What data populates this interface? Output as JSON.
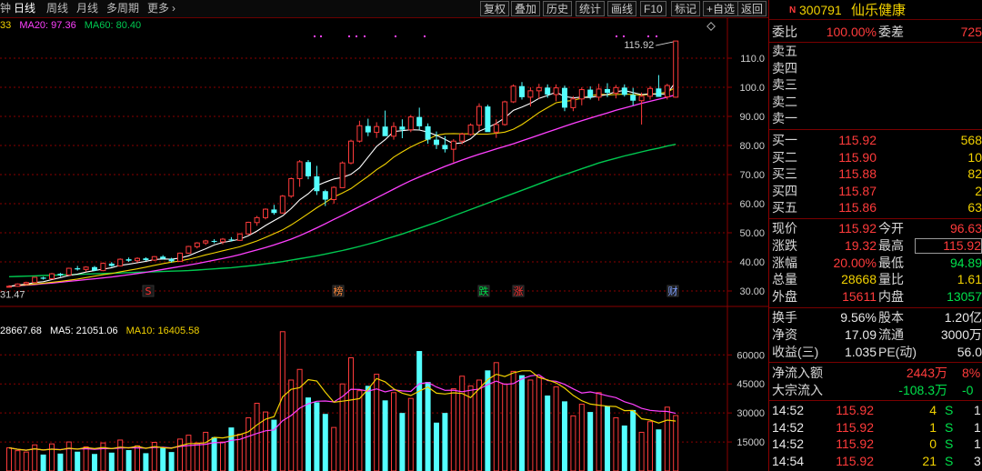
{
  "toolbar": {
    "period_tabs": [
      {
        "label": "钟",
        "active": false
      },
      {
        "label": "日线",
        "active": true
      },
      {
        "label": "周线",
        "active": false
      },
      {
        "label": "月线",
        "active": false
      },
      {
        "label": "多周期",
        "active": false
      },
      {
        "label": "更多",
        "active": false
      }
    ],
    "more_chevron": "›",
    "buttons": [
      "复权",
      "叠加",
      "历史",
      "统计",
      "画线",
      "F10",
      "标记",
      "+自选",
      "返回"
    ]
  },
  "price_legend": {
    "partial": "33",
    "ma20": "MA20: 97.36",
    "ma60": "MA60: 80.40"
  },
  "volume_legend": {
    "vol": "28667.68",
    "ma5": "MA5: 21051.06",
    "ma10": "MA10: 16405.58"
  },
  "price_axis": {
    "ticks": [
      "110.0",
      "100.0",
      "90.00",
      "80.00",
      "70.00",
      "60.00",
      "50.00",
      "40.00",
      "30.00"
    ],
    "high_label": "115.92",
    "low_label": "31.47"
  },
  "volume_axis": {
    "ticks": [
      "60000",
      "45000",
      "30000",
      "15000"
    ]
  },
  "event_markers": [
    {
      "text": "S",
      "color": "#ff3030"
    },
    {
      "text": "榜",
      "color": "#ff8a3c"
    },
    {
      "text": "跌",
      "color": "#00e14b"
    },
    {
      "text": "涨",
      "color": "#ff3030"
    },
    {
      "text": "财",
      "color": "#7fa0ff"
    }
  ],
  "colors": {
    "up": "#ff3b3b",
    "down": "#54ffff",
    "ma5": "#ffffff",
    "ma10": "#f2d200",
    "ma20": "#ff40ff",
    "ma60": "#00c850",
    "grid": "#8a0000"
  },
  "chart_data": [
    {
      "type": "candlestick",
      "title": "",
      "ylim": [
        30,
        120
      ],
      "series_names": [
        "MA20",
        "MA60"
      ],
      "last_close": 115.92,
      "low_marker": 31.47,
      "ohlc": [
        [
          31.5,
          32.0,
          31.2,
          31.6
        ],
        [
          31.6,
          32.6,
          31.4,
          32.4
        ],
        [
          32.4,
          33.2,
          32.0,
          32.9
        ],
        [
          32.9,
          34.8,
          32.7,
          34.7
        ],
        [
          34.6,
          34.9,
          33.9,
          34.2
        ],
        [
          34.2,
          36.2,
          34.0,
          35.9
        ],
        [
          35.9,
          36.2,
          34.9,
          35.4
        ],
        [
          35.5,
          38.0,
          35.3,
          37.8
        ],
        [
          37.8,
          38.6,
          37.0,
          37.4
        ],
        [
          37.4,
          38.5,
          36.6,
          38.2
        ],
        [
          38.2,
          38.6,
          36.8,
          37.0
        ],
        [
          37.0,
          39.8,
          36.8,
          39.5
        ],
        [
          39.4,
          39.9,
          38.3,
          38.6
        ],
        [
          38.6,
          41.2,
          38.4,
          40.9
        ],
        [
          40.9,
          41.5,
          40.0,
          40.4
        ],
        [
          40.4,
          41.6,
          39.8,
          41.2
        ],
        [
          41.2,
          41.6,
          40.2,
          40.6
        ],
        [
          40.6,
          42.0,
          40.3,
          41.8
        ],
        [
          41.8,
          42.3,
          40.8,
          41.1
        ],
        [
          41.0,
          41.4,
          39.8,
          40.2
        ],
        [
          40.2,
          43.2,
          40.0,
          43.0
        ],
        [
          43.0,
          45.5,
          42.8,
          45.3
        ],
        [
          45.2,
          46.8,
          44.6,
          46.5
        ],
        [
          46.5,
          47.6,
          45.8,
          47.2
        ],
        [
          47.2,
          47.8,
          46.4,
          46.9
        ],
        [
          46.9,
          48.2,
          46.0,
          47.8
        ],
        [
          47.7,
          48.5,
          47.0,
          47.4
        ],
        [
          47.4,
          49.8,
          47.2,
          49.6
        ],
        [
          49.6,
          53.8,
          49.4,
          53.6
        ],
        [
          53.5,
          55.8,
          52.4,
          55.2
        ],
        [
          55.2,
          58.4,
          54.6,
          58.1
        ],
        [
          58.0,
          59.6,
          56.2,
          56.8
        ],
        [
          56.8,
          63.0,
          56.6,
          62.6
        ],
        [
          62.6,
          69.0,
          62.0,
          68.6
        ],
        [
          68.6,
          75.0,
          65.8,
          74.4
        ],
        [
          74.3,
          75.0,
          68.4,
          69.4
        ],
        [
          69.4,
          73.0,
          63.0,
          64.3
        ],
        [
          64.3,
          64.8,
          59.2,
          61.4
        ],
        [
          61.4,
          66.0,
          60.0,
          65.6
        ],
        [
          65.5,
          74.5,
          65.4,
          74.0
        ],
        [
          74.0,
          82.0,
          73.5,
          81.5
        ],
        [
          81.5,
          88.5,
          81.0,
          86.8
        ],
        [
          86.7,
          89.2,
          83.2,
          84.5
        ],
        [
          84.5,
          88.0,
          82.6,
          86.5
        ],
        [
          86.5,
          92.0,
          85.5,
          83.2
        ],
        [
          83.2,
          88.0,
          82.0,
          86.5
        ],
        [
          86.5,
          89.0,
          82.5,
          85.4
        ],
        [
          85.4,
          90.5,
          84.6,
          89.8
        ],
        [
          89.8,
          93.0,
          85.4,
          86.6
        ],
        [
          86.6,
          87.6,
          80.6,
          82.0
        ],
        [
          82.0,
          84.8,
          78.8,
          80.2
        ],
        [
          80.2,
          83.2,
          77.6,
          78.7
        ],
        [
          78.7,
          82.2,
          74.2,
          81.5
        ],
        [
          81.5,
          84.4,
          80.4,
          83.9
        ],
        [
          83.8,
          87.6,
          83.4,
          87.0
        ],
        [
          87.0,
          94.5,
          85.0,
          93.4
        ],
        [
          93.4,
          94.0,
          84.8,
          84.6
        ],
        [
          84.6,
          89.0,
          82.6,
          87.2
        ],
        [
          87.2,
          95.4,
          86.8,
          95.0
        ],
        [
          95.0,
          101.0,
          94.6,
          100.4
        ],
        [
          100.4,
          101.8,
          95.8,
          96.6
        ],
        [
          96.6,
          100.0,
          93.4,
          98.8
        ],
        [
          98.8,
          101.2,
          96.0,
          99.9
        ],
        [
          99.9,
          101.0,
          96.4,
          97.5
        ],
        [
          97.5,
          101.0,
          95.2,
          99.8
        ],
        [
          99.8,
          100.6,
          91.8,
          93.0
        ],
        [
          93.0,
          97.0,
          91.8,
          96.0
        ],
        [
          96.0,
          100.0,
          93.8,
          99.2
        ],
        [
          99.2,
          100.3,
          95.8,
          96.6
        ],
        [
          96.6,
          101.2,
          95.4,
          99.4
        ],
        [
          99.4,
          101.4,
          96.6,
          98.1
        ],
        [
          98.0,
          100.8,
          96.2,
          99.9
        ],
        [
          99.9,
          101.0,
          96.8,
          97.4
        ],
        [
          97.4,
          99.8,
          93.8,
          95.4
        ],
        [
          95.4,
          98.2,
          87.2,
          96.9
        ],
        [
          96.9,
          100.4,
          95.8,
          99.6
        ],
        [
          99.6,
          104.2,
          97.6,
          96.7
        ],
        [
          96.7,
          101.2,
          95.8,
          100.6
        ],
        [
          96.6,
          115.9,
          96.4,
          115.9
        ]
      ],
      "ma5": [
        31.6,
        32.0,
        32.3,
        32.9,
        33.2,
        33.9,
        34.6,
        35.3,
        35.8,
        36.5,
        37.0,
        37.5,
        38.0,
        38.8,
        39.2,
        39.7,
        40.2,
        40.8,
        41.0,
        40.9,
        41.3,
        42.1,
        43.3,
        44.5,
        45.8,
        46.7,
        47.2,
        47.8,
        49.0,
        50.6,
        52.5,
        54.2,
        55.8,
        58.3,
        61.3,
        63.4,
        66.2,
        67.4,
        68.5,
        69.0,
        70.1,
        72.3,
        76.0,
        79.7,
        82.0,
        84.8,
        85.1,
        85.4,
        85.3,
        84.6,
        83.5,
        82.1,
        80.6,
        80.9,
        82.3,
        84.9,
        86.2,
        87.6,
        89.5,
        92.1,
        93.2,
        94.5,
        96.2,
        97.2,
        98.3,
        96.8,
        96.4,
        96.6,
        96.5,
        97.0,
        97.5,
        98.5,
        98.9,
        98.2,
        97.5,
        97.8,
        97.5,
        97.8,
        101.9
      ],
      "ma10": [
        31.6,
        31.9,
        32.1,
        32.4,
        32.7,
        33.0,
        33.3,
        33.7,
        34.1,
        34.6,
        35.1,
        35.6,
        36.0,
        36.6,
        37.1,
        37.6,
        38.2,
        38.8,
        39.4,
        39.9,
        40.3,
        40.9,
        41.6,
        42.4,
        43.1,
        43.8,
        44.5,
        45.2,
        46.2,
        47.2,
        48.4,
        49.7,
        51.0,
        52.7,
        54.6,
        56.6,
        58.6,
        60.4,
        62.3,
        63.7,
        65.2,
        67.3,
        69.4,
        71.7,
        73.6,
        76.0,
        77.8,
        79.5,
        80.9,
        82.1,
        83.5,
        84.0,
        84.1,
        84.0,
        84.0,
        83.9,
        83.9,
        84.2,
        84.6,
        85.6,
        87.2,
        89.2,
        91.3,
        93.0,
        94.7,
        95.2,
        95.5,
        96.3,
        97.0,
        97.7,
        97.4,
        97.5,
        97.7,
        97.5,
        97.3,
        97.6,
        97.9,
        98.3,
        100.0
      ],
      "ma20": [
        31.6,
        31.8,
        32.0,
        32.2,
        32.5,
        32.7,
        33.0,
        33.3,
        33.6,
        33.9,
        34.2,
        34.5,
        34.8,
        35.2,
        35.6,
        36.0,
        36.4,
        36.9,
        37.4,
        37.9,
        38.4,
        38.9,
        39.4,
        40.0,
        40.6,
        41.2,
        41.8,
        42.5,
        43.3,
        44.1,
        44.9,
        45.8,
        46.8,
        47.8,
        49.0,
        50.3,
        51.7,
        53.1,
        54.6,
        56.0,
        57.5,
        59.0,
        60.5,
        62.0,
        63.5,
        65.0,
        66.5,
        67.9,
        69.2,
        70.4,
        71.6,
        72.8,
        73.9,
        75.0,
        76.0,
        77.0,
        77.9,
        78.8,
        79.7,
        80.6,
        81.6,
        82.6,
        83.6,
        84.6,
        85.6,
        86.6,
        87.6,
        88.5,
        89.4,
        90.3,
        91.2,
        92.1,
        92.9,
        93.7,
        94.5,
        95.2,
        95.9,
        96.6,
        97.4
      ],
      "ma60": [
        34.9,
        35.0,
        35.1,
        35.2,
        35.3,
        35.4,
        35.5,
        35.6,
        35.7,
        35.8,
        35.9,
        36.0,
        36.1,
        36.2,
        36.3,
        36.4,
        36.5,
        36.6,
        36.7,
        36.8,
        36.9,
        37.0,
        37.2,
        37.4,
        37.6,
        37.8,
        38.0,
        38.3,
        38.6,
        38.9,
        39.3,
        39.7,
        40.1,
        40.6,
        41.1,
        41.6,
        42.1,
        42.7,
        43.3,
        43.9,
        44.6,
        45.3,
        46.1,
        46.9,
        47.8,
        48.7,
        49.6,
        50.6,
        51.6,
        52.6,
        53.6,
        54.7,
        55.8,
        56.9,
        58.0,
        59.1,
        60.2,
        61.3,
        62.4,
        63.5,
        64.6,
        65.7,
        66.8,
        67.9,
        69.0,
        70.0,
        71.0,
        72.0,
        73.0,
        74.0,
        74.8,
        75.6,
        76.4,
        77.1,
        77.8,
        78.5,
        79.1,
        79.8,
        80.4
      ]
    },
    {
      "type": "bar",
      "title": "",
      "ylim": [
        0,
        78000
      ],
      "series_names": [
        "MA5",
        "MA10"
      ],
      "volume": [
        12000,
        10500,
        9800,
        13500,
        8500,
        14000,
        9000,
        15000,
        10000,
        12500,
        8800,
        14500,
        9500,
        16000,
        10800,
        13000,
        9200,
        14800,
        12000,
        9800,
        16500,
        18500,
        14500,
        20000,
        17500,
        15000,
        22500,
        19000,
        27500,
        35000,
        30500,
        26500,
        72000,
        47000,
        52500,
        38000,
        35500,
        29500,
        22500,
        45000,
        58500,
        41500,
        44000,
        50000,
        36500,
        40500,
        30000,
        37500,
        62000,
        46000,
        25000,
        30000,
        42500,
        49000,
        44000,
        47000,
        52000,
        56000,
        45000,
        51500,
        49500,
        47000,
        48500,
        39000,
        43500,
        36000,
        28500,
        34500,
        30500,
        40500,
        33500,
        27500,
        23500,
        31500,
        20000,
        25500,
        21500,
        33000,
        28668
      ],
      "ma5": [
        12000,
        11250,
        10767,
        11450,
        10860,
        11260,
        10960,
        11800,
        11300,
        12100,
        11560,
        12160,
        11560,
        12360,
        11920,
        12760,
        11700,
        12660,
        12020,
        11760,
        13060,
        14200,
        14180,
        14660,
        17400,
        17100,
        17900,
        18800,
        20300,
        23800,
        26800,
        28100,
        38300,
        42200,
        43100,
        47200,
        46500,
        40700,
        35500,
        36100,
        36700,
        37400,
        42300,
        47800,
        46100,
        42500,
        40200,
        39000,
        41300,
        43400,
        40200,
        39800,
        40400,
        40100,
        37900,
        42500,
        47200,
        50000,
        48800,
        50700,
        51800,
        51800,
        48300,
        47100,
        45600,
        42800,
        39100,
        36300,
        34600,
        34000,
        33500,
        33300,
        31200,
        31300,
        27000,
        26300,
        24800,
        26300,
        25800
      ],
      "ma10": [
        12000,
        11250,
        10767,
        11450,
        10860,
        11383,
        11043,
        11538,
        11378,
        11490,
        11170,
        11570,
        11540,
        11840,
        12010,
        11940,
        11830,
        12130,
        12330,
        11930,
        12690,
        13170,
        13420,
        13820,
        14730,
        14620,
        15830,
        16330,
        17900,
        19400,
        20790,
        21260,
        25990,
        28680,
        32470,
        34760,
        36060,
        36180,
        35690,
        38440,
        42230,
        42080,
        41250,
        42450,
        40890,
        41950,
        41400,
        41130,
        45040,
        45780,
        43420,
        41700,
        41770,
        40990,
        41730,
        42380,
        44600,
        46450,
        44750,
        45160,
        47610,
        49130,
        49700,
        46710,
        46390,
        44770,
        42420,
        40320,
        40860,
        39970,
        38850,
        37930,
        35810,
        34430,
        32390,
        31330,
        30970,
        30760,
        29800
      ]
    }
  ],
  "quote": {
    "code": "300791",
    "name": "仙乐健康",
    "n_tag": "N",
    "weibi_label": "委比",
    "weibi_value": "100.00%",
    "weicha_label": "委差",
    "weicha_value": "725",
    "sells": [
      {
        "label": "卖五",
        "price": "",
        "vol": ""
      },
      {
        "label": "卖四",
        "price": "",
        "vol": ""
      },
      {
        "label": "卖三",
        "price": "",
        "vol": ""
      },
      {
        "label": "卖二",
        "price": "",
        "vol": ""
      },
      {
        "label": "卖一",
        "price": "",
        "vol": ""
      }
    ],
    "buys": [
      {
        "label": "买一",
        "price": "115.92",
        "vol": "568"
      },
      {
        "label": "买二",
        "price": "115.90",
        "vol": "10"
      },
      {
        "label": "买三",
        "price": "115.88",
        "vol": "82"
      },
      {
        "label": "买四",
        "price": "115.87",
        "vol": "2"
      },
      {
        "label": "买五",
        "price": "115.86",
        "vol": "63"
      }
    ],
    "stats": [
      {
        "l1": "现价",
        "v1": "115.92",
        "l2": "今开",
        "v2": "96.63"
      },
      {
        "l1": "涨跌",
        "v1": "19.32",
        "l2": "最高",
        "v2": "115.92"
      },
      {
        "l1": "涨幅",
        "v1": "20.00%",
        "l2": "最低",
        "v2": "94.89"
      },
      {
        "l1": "总量",
        "v1": "28668",
        "l2": "量比",
        "v2": "1.61"
      },
      {
        "l1": "外盘",
        "v1": "15611",
        "l2": "内盘",
        "v2": "13057"
      }
    ],
    "fundamentals": [
      {
        "l1": "换手",
        "v1": "9.56%",
        "l2": "股本",
        "v2": "1.20亿"
      },
      {
        "l1": "净资",
        "v1": "17.09",
        "l2": "流通",
        "v2": "3000万"
      },
      {
        "l1": "收益(三)",
        "v1": "1.035",
        "l2": "PE(动)",
        "v2": "56.0"
      }
    ],
    "flows": [
      {
        "label": "净流入额",
        "value": "2443万",
        "pct": "8%"
      },
      {
        "label": "大宗流入",
        "value": "-108.3万",
        "pct": "-0"
      }
    ],
    "ticks": [
      {
        "time": "14:52",
        "price": "115.92",
        "vol": "4",
        "dir": "S"
      },
      {
        "time": "14:52",
        "price": "115.92",
        "vol": "1",
        "dir": "S"
      },
      {
        "time": "14:52",
        "price": "115.92",
        "vol": "0",
        "dir": "S"
      },
      {
        "time": "14:54",
        "price": "115.92",
        "vol": "21",
        "dir": "S"
      }
    ],
    "tick_extra": [
      "1",
      "1",
      "1",
      "3"
    ]
  }
}
